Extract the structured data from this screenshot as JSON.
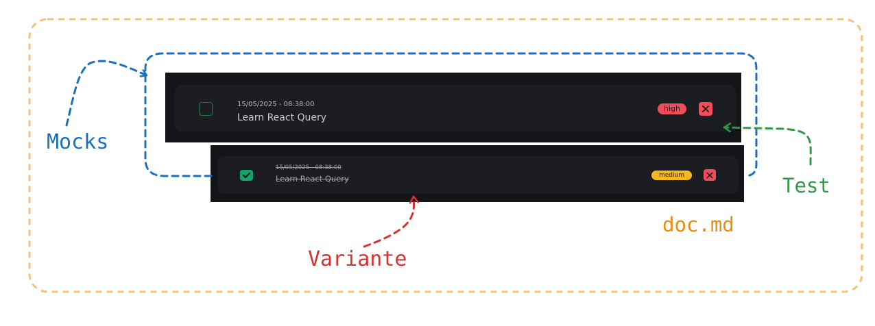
{
  "todos": [
    {
      "date": "15/05/2025 - 08:38:00",
      "title": "Learn React Query",
      "priority": "high",
      "completed": false,
      "priority_color": "#f24b5a"
    },
    {
      "date": "15/05/2025 - 08:38:00",
      "title": "Learn React Query",
      "priority": "medium",
      "completed": true,
      "priority_color": "#f6b81f"
    }
  ],
  "annotations": {
    "mocks": {
      "label": "Mocks",
      "color": "#1b6fbf"
    },
    "test": {
      "label": "Test",
      "color": "#2f9a45"
    },
    "doc": {
      "label": "doc.md",
      "color": "#e98d0e"
    },
    "variante": {
      "label": "Variante",
      "color": "#d63330"
    }
  },
  "icons": {
    "checkbox": "checkbox-empty-icon",
    "checked": "check-icon",
    "delete": "close-icon"
  }
}
